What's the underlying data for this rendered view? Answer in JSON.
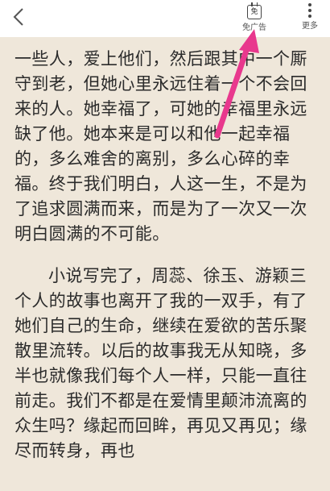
{
  "toolbar": {
    "back_icon": "chevron-left-icon",
    "noad_icon_text": "免",
    "noad_label": "免广告",
    "more_label": "更多"
  },
  "reader": {
    "paragraphs": [
      "一些人，爱上他们，然后跟其中一个厮守到老，但她心里永远住着一个不会回来的人。她幸福了，可她的幸福里永远缺了他。她本来是可以和他一起幸福的，多么难舍的离别，多么心碎的幸福。终于我们明白，人这一生，不是为了追求圆满而来，而是为了一次又一次明白圆满的不可能。",
      "小说写完了，周蕊、徐玉、游颖三个人的故事也离开了我的一双手，有了她们自己的生命，继续在爱欲的苦乐聚散里流转。以后的故事我无从知晓，多半也就像我们每个人一样，只能一直往前走。我们不都是在爱情里颠沛流离的众生吗？缘起而回眸，再见又再见；缘尽而转身，再也"
    ]
  },
  "annotation": {
    "arrow_color": "#e8388d"
  },
  "colors": {
    "page_bg": "#efe7da",
    "bar_bg": "#ffffff",
    "text": "#2b2b2b"
  }
}
